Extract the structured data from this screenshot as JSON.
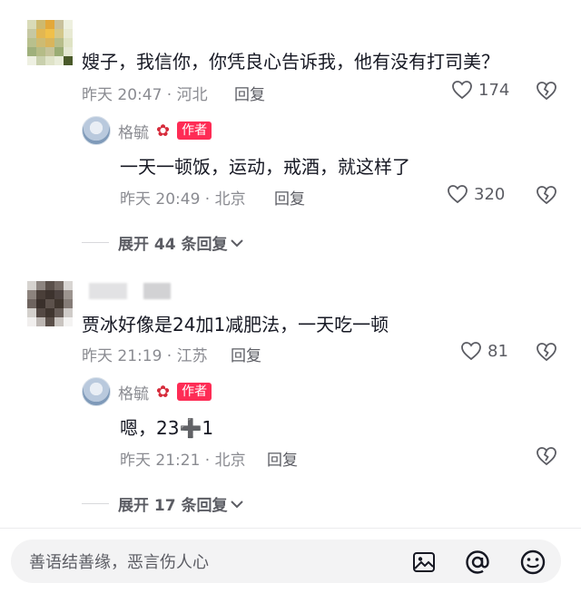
{
  "comments": [
    {
      "text": "嫂子，我信你，你凭良心告诉我，他有没有打司美？",
      "time_location": "昨天 20:47 · 河北",
      "reply_label": "回复",
      "likes": "174",
      "author_reply": {
        "name": "格毓",
        "badge": "作者",
        "text": "一天一顿饭，运动，戒酒，就这样了",
        "time_location": "昨天 20:49 · 北京",
        "reply_label": "回复",
        "likes": "320"
      },
      "expand_label": "展开 44 条回复"
    },
    {
      "text": "贾冰好像是24加1减肥法，一天吃一顿",
      "time_location": "昨天 21:19 · 江苏",
      "reply_label": "回复",
      "likes": "81",
      "author_reply": {
        "name": "格毓",
        "badge": "作者",
        "text": "嗯，23➕1",
        "time_location": "昨天 21:21 · 北京",
        "reply_label": "回复"
      },
      "expand_label": "展开 17 条回复"
    }
  ],
  "input": {
    "placeholder": "善语结善缘，恶言伤人心"
  },
  "icons": {
    "image": "image-icon",
    "mention": "at-icon",
    "emoji": "emoji-icon",
    "like": "heart-icon",
    "dislike": "broken-heart-icon",
    "expand": "chevron-down-icon"
  },
  "colors": {
    "badge": "#fe2c55",
    "meta": "#8a8b91"
  }
}
